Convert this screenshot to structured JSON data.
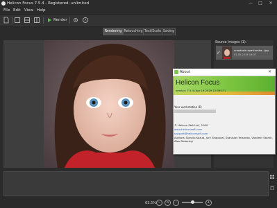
{
  "window": {
    "title": "Helicon Focus 7.5.4 - Registered: unlimited",
    "minimize_glyph": "—",
    "maximize_glyph": "□",
    "close_glyph": "✕"
  },
  "menu": {
    "items": [
      "File",
      "Edit",
      "View",
      "Help"
    ]
  },
  "toolbar": {
    "render_label": "Render",
    "icons": [
      "add-file-icon",
      "view-single-icon",
      "view-split-icon",
      "view-compare-icon",
      "settings-icon",
      "render-icon",
      "help-icon"
    ]
  },
  "tabs": [
    {
      "label": "Rendering",
      "active": true
    },
    {
      "label": "Retouching",
      "active": false
    },
    {
      "label": "Text/Scale",
      "active": false
    },
    {
      "label": "Saving",
      "active": false
    }
  ],
  "source_panel": {
    "label": "Source images (1):",
    "items": [
      {
        "name": "anastasia-spaslavska...jpg",
        "date": "01.05.2019 16:07"
      }
    ]
  },
  "statusbar": {
    "zoom": "63.5%"
  },
  "about": {
    "title": "About",
    "product": "Helicon Focus",
    "version": "version: 7.5.4 (Apr 19 2019 12:39:17)",
    "workstation_label": "Your workstation ID:",
    "copyright": "© Helicon Soft Ltd., 2000",
    "link1": "www.heliconsoft.com",
    "link2": "support@heliconsoft.com",
    "authors": "Authors: Danylo Kozub, Jury Shapoval, Stanislav Yelsenko, Vladimir Starkh, Alex Dobenkyi",
    "colors": {
      "banner": "#7cc440",
      "link": "#2a5db0"
    }
  }
}
